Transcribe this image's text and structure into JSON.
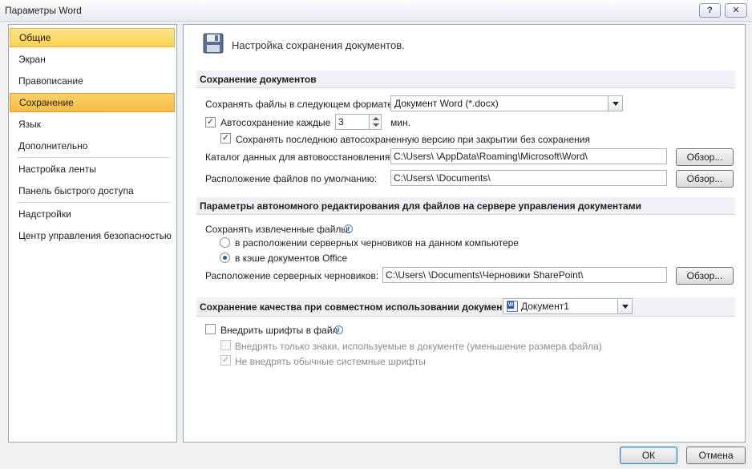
{
  "window": {
    "title": "Параметры Word",
    "help_glyph": "?",
    "close_glyph": "✕"
  },
  "sidebar": {
    "items": [
      {
        "label": "Общие"
      },
      {
        "label": "Экран"
      },
      {
        "label": "Правописание"
      },
      {
        "label": "Сохранение"
      },
      {
        "label": "Язык"
      },
      {
        "label": "Дополнительно"
      },
      {
        "label": "Настройка ленты"
      },
      {
        "label": "Панель быстрого доступа"
      },
      {
        "label": "Надстройки"
      },
      {
        "label": "Центр управления безопасностью"
      }
    ],
    "active_item": "Сохранение",
    "hovered_item": "Общие"
  },
  "header": {
    "title": "Настройка сохранения документов.",
    "icon": "floppy-disk-icon"
  },
  "save_section": {
    "heading": "Сохранение документов",
    "format_label": "Сохранять файлы в следующем формате:",
    "format_value": "Документ Word (*.docx)",
    "autosave_label": "Автосохранение каждые",
    "autosave_checked": true,
    "autosave_value": "3",
    "autosave_unit": "мин.",
    "keep_last_label": "Сохранять последнюю автосохраненную версию при закрытии без сохранения",
    "keep_last_checked": true,
    "autorecover_label": "Каталог данных для автовосстановления:",
    "autorecover_path": "C:\\Users\\                   \\AppData\\Roaming\\Microsoft\\Word\\",
    "default_location_label": "Расположение файлов по умолчанию:",
    "default_location_path": "C:\\Users\\                   \\Documents\\",
    "browse_label": "Обзор..."
  },
  "offline_section": {
    "heading": "Параметры автономного редактирования для файлов на сервере управления документами",
    "save_checked_out_label": "Сохранять извлеченные файлы:",
    "option_server_drafts": "в расположении серверных черновиков на данном компьютере",
    "option_office_cache": "в кэше документов Office",
    "selected_option": "в кэше документов Office",
    "server_drafts_label": "Расположение серверных черновиков:",
    "server_drafts_path": "C:\\Users\\                   \\Documents\\Черновики SharePoint\\",
    "browse_label": "Обзор..."
  },
  "fidelity_section": {
    "heading": "Сохранение качества при совместном использовании документа:",
    "document_value": "Документ1",
    "embed_fonts_label": "Внедрить шрифты в файл",
    "embed_fonts_checked": false,
    "embed_only_used_label": "Внедрять только знаки, используемые в документе (уменьшение размера файла)",
    "embed_only_used_checked": false,
    "no_common_fonts_label": "Не внедрять обычные системные шрифты",
    "no_common_fonts_checked": true
  },
  "footer": {
    "ok_label": "ОК",
    "cancel_label": "Отмена"
  },
  "glyphs": {
    "check": "✓",
    "info": "i"
  }
}
